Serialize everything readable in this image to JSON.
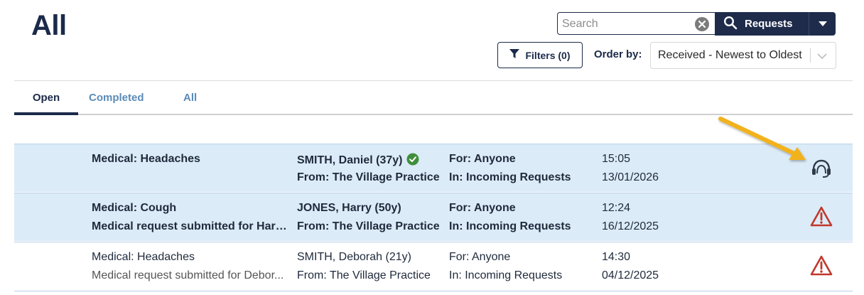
{
  "header": {
    "title": "All"
  },
  "search": {
    "placeholder": "Search",
    "value": "",
    "button_label": "Requests",
    "icons": {
      "clear": "clear-icon",
      "search": "search-icon",
      "dropdown": "chevron-down-icon"
    }
  },
  "filters": {
    "label": "Filters (0)",
    "icon": "filter-icon"
  },
  "order": {
    "label": "Order by:",
    "value": "Received - Newest to Oldest"
  },
  "tabs": [
    {
      "label": "Open",
      "active": true
    },
    {
      "label": "Completed",
      "active": false
    },
    {
      "label": "All",
      "active": false
    }
  ],
  "rows": [
    {
      "title": "Medical: Headaches",
      "subtitle": "",
      "patient": "SMITH, Daniel (37y)",
      "verified": true,
      "from": "From: The Village Practice",
      "for": "For: Anyone",
      "in": "In: Incoming Requests",
      "time": "15:05",
      "date": "13/01/2026",
      "status_icon": "headset-icon",
      "unread": true
    },
    {
      "title": "Medical: Cough",
      "subtitle": "Medical request submitted for Harry...",
      "patient": "JONES, Harry (50y)",
      "verified": false,
      "from": "From: The Village Practice",
      "for": "For: Anyone",
      "in": "In: Incoming Requests",
      "time": "12:24",
      "date": "16/12/2025",
      "status_icon": "warning-icon",
      "unread": true
    },
    {
      "title": "Medical: Headaches",
      "subtitle": "Medical request submitted for Debor...",
      "patient": "SMITH, Deborah (21y)",
      "verified": false,
      "from": "From: The Village Practice",
      "for": "For: Anyone",
      "in": "In: Incoming Requests",
      "time": "14:30",
      "date": "04/12/2025",
      "status_icon": "warning-icon",
      "unread": false
    }
  ],
  "colors": {
    "navy": "#1e2b4b",
    "tab_inactive": "#5a8bb8",
    "row_highlight": "#dcebf8",
    "warning": "#c0392b",
    "verified": "#3f8f3a",
    "annotation_arrow": "#f2b21b"
  }
}
